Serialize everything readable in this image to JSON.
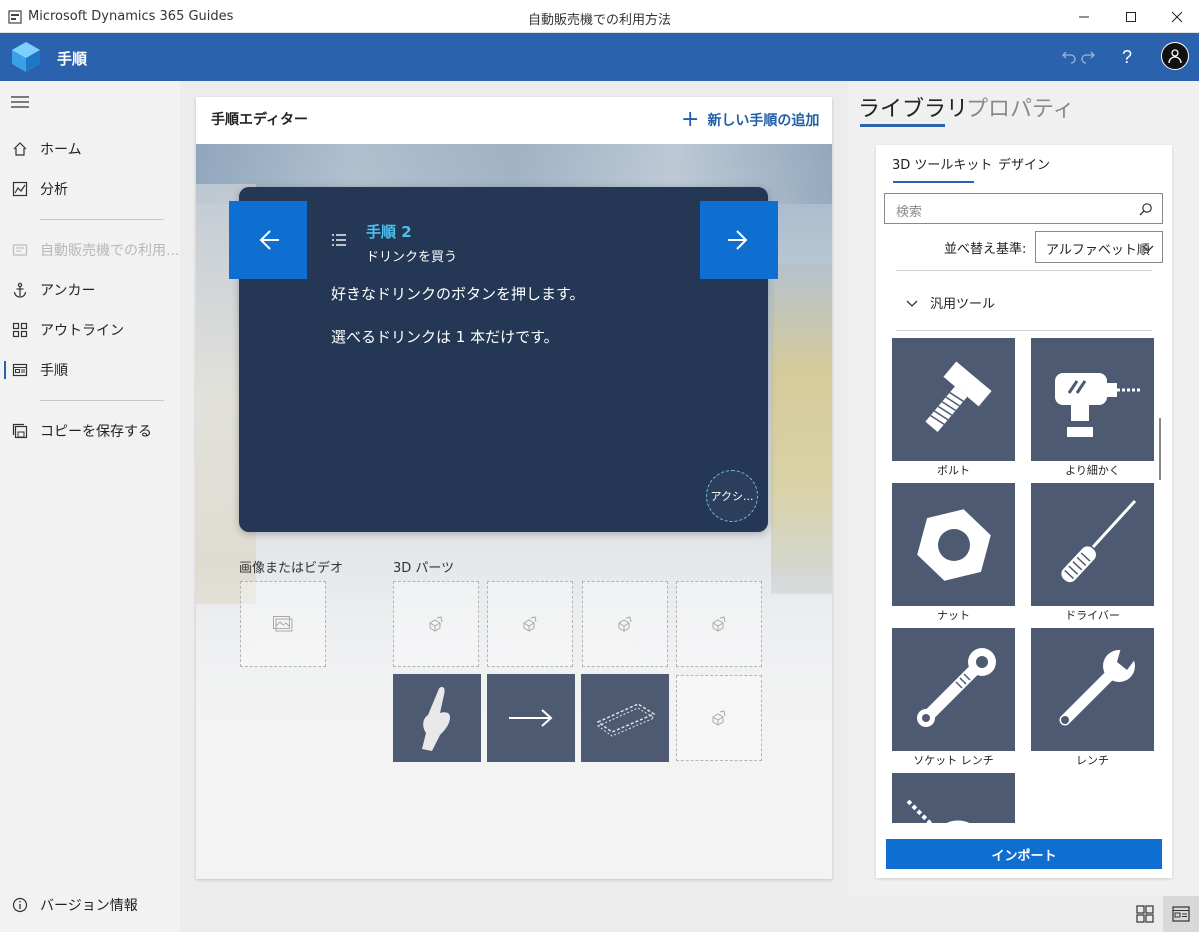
{
  "window": {
    "app_name": "Microsoft Dynamics 365 Guides",
    "document_title": "自動販売機での利用方法"
  },
  "header": {
    "title": "手順"
  },
  "sidebar": {
    "items": [
      {
        "label": "ホーム",
        "icon": "home-icon"
      },
      {
        "label": "分析",
        "icon": "analytics-icon"
      },
      {
        "label": "自動販売機での利用...",
        "icon": "guide-icon",
        "disabled": true
      },
      {
        "label": "アンカー",
        "icon": "anchor-icon"
      },
      {
        "label": "アウトライン",
        "icon": "outline-icon"
      },
      {
        "label": "手順",
        "icon": "steps-icon",
        "active": true
      },
      {
        "label": "コピーを保存する",
        "icon": "save-copy-icon"
      }
    ],
    "footer": {
      "label": "バージョン情報",
      "icon": "info-icon"
    }
  },
  "editor": {
    "title": "手順エディター",
    "add_step_label": "新しい手順の追加",
    "step_number": "手順 2",
    "step_title": "ドリンクを買う",
    "step_text_1": "好きなドリンクのボタンを押します。",
    "step_text_2": "選べるドリンクは 1 本だけです。",
    "action_label": "アクシ...",
    "media_label": "画像またはビデオ",
    "parts_label": "3D パーツ"
  },
  "right_panel": {
    "tabs": [
      {
        "label": "ライブラリ",
        "active": true
      },
      {
        "label": "プロパティ",
        "active": false
      }
    ],
    "subtabs": [
      {
        "label": "3D ツールキット",
        "active": true
      },
      {
        "label": "デザイン",
        "active": false
      }
    ],
    "search_placeholder": "検索",
    "sort_label": "並べ替え基準:",
    "sort_value": "アルファベット順",
    "group_label": "汎用ツール",
    "tiles": [
      {
        "label": "ボルト",
        "icon": "bolt-icon"
      },
      {
        "label": "より細かく",
        "icon": "drill-icon"
      },
      {
        "label": "ナット",
        "icon": "nut-icon"
      },
      {
        "label": "ドライバー",
        "icon": "screwdriver-icon"
      },
      {
        "label": "ソケット レンチ",
        "icon": "socket-wrench-icon"
      },
      {
        "label": "レンチ",
        "icon": "wrench-icon"
      },
      {
        "label": "",
        "icon": "tape-measure-icon"
      }
    ],
    "import_label": "インポート"
  },
  "colors": {
    "header_blue": "#2b62ad",
    "accent_blue": "#0f6fd0",
    "step_card": "#243754",
    "tile_bg": "#4e5a72",
    "step_number": "#4cc2f1"
  }
}
